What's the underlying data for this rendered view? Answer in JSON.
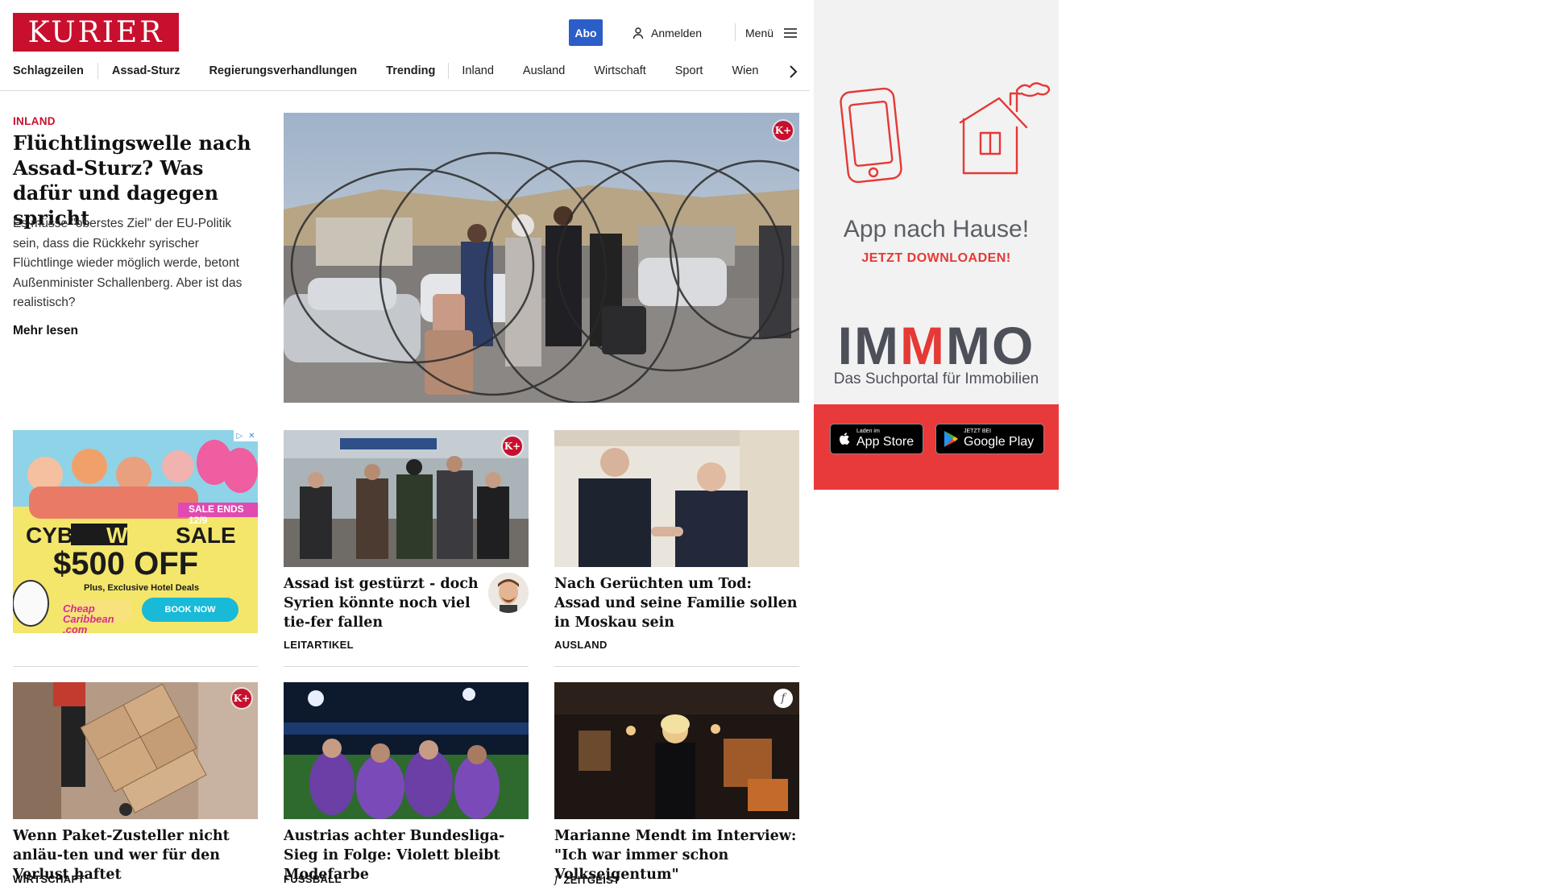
{
  "header": {
    "logo_text": "KURIER",
    "abo_label": "Abo",
    "login_label": "Anmelden",
    "menu_label": "Menü",
    "colors": {
      "brand_red": "#c8102e",
      "abo_blue": "#2b5ec8"
    }
  },
  "nav": {
    "items": [
      {
        "label": "Schlagzeilen"
      },
      {
        "label": "Assad-Sturz"
      },
      {
        "label": "Regierungsverhandlungen"
      },
      {
        "label": "Trending"
      },
      {
        "label": "Inland"
      },
      {
        "label": "Ausland"
      },
      {
        "label": "Wirtschaft"
      },
      {
        "label": "Sport"
      },
      {
        "label": "Wien"
      }
    ],
    "next_icon": "chevron-right-icon"
  },
  "lead": {
    "kicker": "INLAND",
    "title": "Flüchtlingswelle nach Assad-Sturz? Was dafür und dagegen spricht",
    "teaser": "Es müsse \"oberstes Ziel\" der EU-Politik sein, dass die Rückkehr syrischer Flüchtlinge wieder möglich werde, betont Außenminister Schallenberg. Aber ist das realistisch?",
    "more": "Mehr lesen",
    "badge": "K+"
  },
  "cards": [
    {
      "title": "Assad ist gestürzt - doch Syrien könnte noch viel tie-fer fallen",
      "kicker": "LEITARTIKEL",
      "badge": "K+"
    },
    {
      "title": "Nach Gerüchten um Tod: Assad und seine Familie sollen in Moskau sein",
      "kicker": "AUSLAND"
    },
    {
      "title": "Wenn Paket-Zusteller nicht anläu-ten und wer für den Verlust haftet",
      "kicker": "WIRTSCHAFT",
      "badge": "K+"
    },
    {
      "title": "Austrias achter Bundesliga-Sieg in Folge: Violett bleibt Modefarbe",
      "kicker": "FUSSBALL"
    },
    {
      "title": "Marianne Mendt im Interview: \"Ich war immer schon Volkseigentum\"",
      "kicker": "ZEITGEIST",
      "badge": "f"
    }
  ],
  "small_ad": {
    "sale_ends": "SALE ENDS 12/9",
    "line1_a": "CYBER",
    "line1_b": "WEEK",
    "line1_c": "SALE",
    "amount": "$500 OFF",
    "sub": "Plus, Exclusive Hotel Deals",
    "brand": "Cheap Caribbean .com",
    "cta": "BOOK NOW"
  },
  "right_ad": {
    "headline": "App nach Hause!",
    "sub": "JETZT DOWNLOADEN!",
    "brand_a": "IM",
    "brand_b": "M",
    "brand_c": "MO",
    "tagline": "Das Suchportal für Immobilien",
    "appstore_small": "Laden im",
    "appstore_big": "App Store",
    "google_small": "JETZT BEI",
    "google_big": "Google Play",
    "colors": {
      "accent_red": "#e53935",
      "text_gray": "#4d5059"
    }
  }
}
